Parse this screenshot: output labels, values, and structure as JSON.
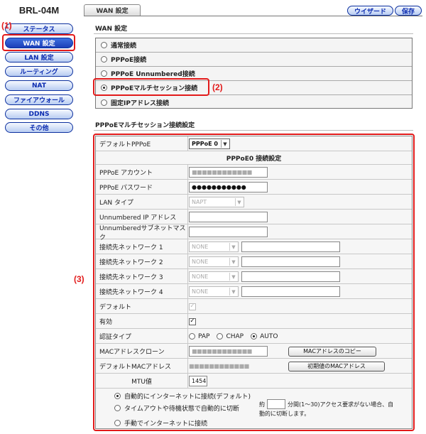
{
  "sidebar": {
    "model": "BRL-04M",
    "items": [
      {
        "label": "ステータス"
      },
      {
        "label": "WAN 設定"
      },
      {
        "label": "LAN 設定"
      },
      {
        "label": "ルーティング"
      },
      {
        "label": "NAT"
      },
      {
        "label": "ファイアウォール"
      },
      {
        "label": "DDNS"
      },
      {
        "label": "その他"
      }
    ],
    "active_index": 1
  },
  "annotations": {
    "label1": "(1)",
    "label2": "(2)",
    "label3": "(3)",
    "color": "#e21a1a"
  },
  "header": {
    "tab": "WAN 設定",
    "wizard_button": "ウイザード",
    "save_button": "保存"
  },
  "wan": {
    "title": "WAN 設定",
    "options": [
      {
        "label": "通常接続",
        "selected": false
      },
      {
        "label": "PPPoE接続",
        "selected": false
      },
      {
        "label": "PPPoE Unnumbered接続",
        "selected": false
      },
      {
        "label": "PPPoEマルチセッション接続",
        "selected": true
      },
      {
        "label": "固定IPアドレス接続",
        "selected": false
      }
    ]
  },
  "multi": {
    "title": "PPPoEマルチセッション接続設定",
    "default_pppoe_label": "デフォルトPPPoE",
    "default_pppoe_value": "PPPoE 0",
    "section_header": "PPPoE0 接続設定",
    "account_label": "PPPoE アカウント",
    "account_value": "■■■■■■■■■■■■",
    "password_label": "PPPoE パスワード",
    "password_value": "●●●●●●●●●●●",
    "lan_type_label": "LAN タイプ",
    "lan_type_value": "NAPT",
    "unnumbered_ip_label": "Unnumbered IP アドレス",
    "unnumbered_mask_label": "Unnumberedサブネットマスク",
    "networks": [
      {
        "label": "接続先ネットワーク 1",
        "value": "NONE"
      },
      {
        "label": "接続先ネットワーク 2",
        "value": "NONE"
      },
      {
        "label": "接続先ネットワーク 3",
        "value": "NONE"
      },
      {
        "label": "接続先ネットワーク 4",
        "value": "NONE"
      }
    ],
    "default_label": "デフォルト",
    "enabled_label": "有効",
    "auth_label": "認証タイプ",
    "auth_options": [
      "PAP",
      "CHAP",
      "AUTO"
    ],
    "auth_selected": "AUTO",
    "mac_clone_label": "MACアドレスクローン",
    "mac_clone_value": "■■■■■■■■■■■■",
    "mac_copy_button": "MACアドレスのコピー",
    "default_mac_label": "デフォルトMACアドレス",
    "default_mac_value": "■■■■■■■■■■■■",
    "default_mac_button": "初期値のMACアドレス",
    "mtu_label": "MTU値",
    "mtu_value": "1454",
    "connection_options": [
      "自動的にインターネットに接続(デフォルト)",
      "タイムアウトや待機状態で自動的に切断",
      "手動でインターネットに接続"
    ],
    "connection_selected": 0,
    "timeout_prefix": "約",
    "timeout_suffix": "分間(1〜30)アクセス要求がない場合、自",
    "timeout_suffix2": "動的に切断します。"
  }
}
